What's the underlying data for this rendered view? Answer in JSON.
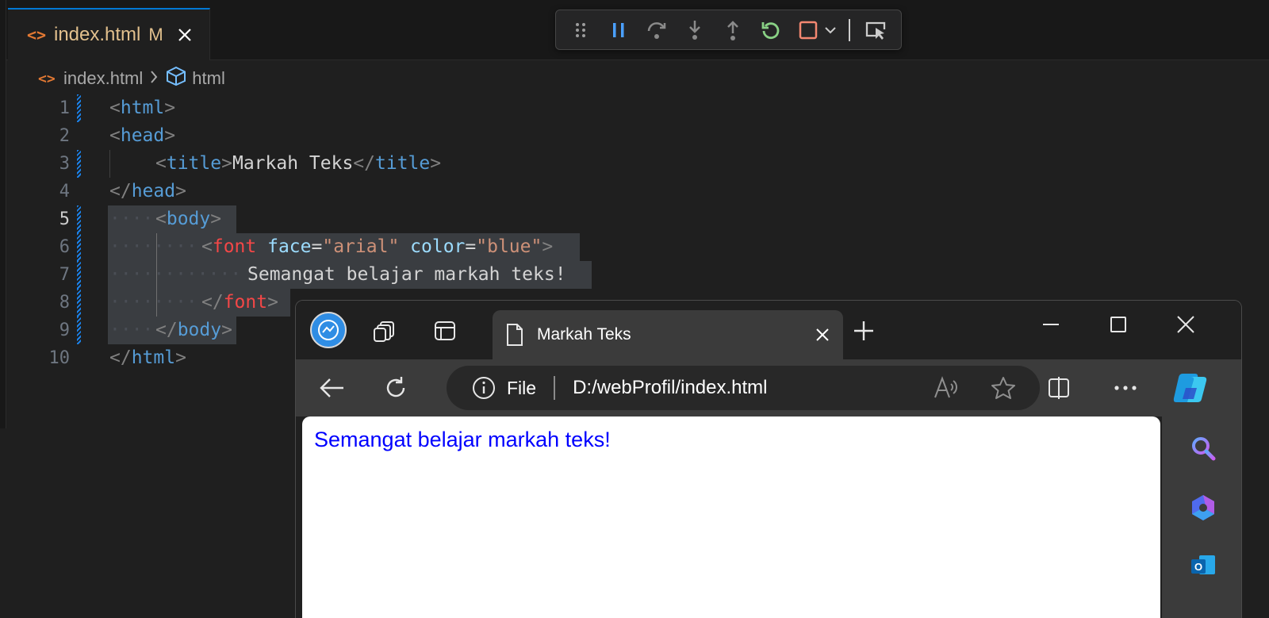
{
  "editor": {
    "tab": {
      "icon": "code-brackets-icon",
      "label": "index.html",
      "modified_badge": "M"
    },
    "breadcrumb": {
      "file": "index.html",
      "symbol": "html"
    },
    "debug_toolbar": [
      "drag-handle-icon",
      "pause-icon",
      "step-over-icon",
      "step-into-icon",
      "step-out-icon",
      "restart-icon",
      "stop-icon",
      "chevron-down-icon",
      "inspect-icon"
    ],
    "lines": [
      {
        "n": "1",
        "tokens": [
          "<",
          "html",
          ">"
        ]
      },
      {
        "n": "2",
        "tokens": [
          "<",
          "head",
          ">"
        ]
      },
      {
        "n": "3",
        "tokens": [
          "<",
          "title",
          ">",
          "Markah Teks",
          "</",
          "title",
          ">"
        ]
      },
      {
        "n": "4",
        "tokens": [
          "</",
          "head",
          ">"
        ]
      },
      {
        "n": "5",
        "tokens": [
          "<",
          "body",
          ">"
        ]
      },
      {
        "n": "6",
        "tokens": [
          "<",
          "font",
          " ",
          "face",
          "=",
          "\"arial\"",
          " ",
          "color",
          "=",
          "\"blue\"",
          ">"
        ]
      },
      {
        "n": "7",
        "tokens": [
          "Semangat belajar markah teks!"
        ]
      },
      {
        "n": "8",
        "tokens": [
          "</",
          "font",
          ">"
        ]
      },
      {
        "n": "9",
        "tokens": [
          "</",
          "body",
          ">"
        ]
      },
      {
        "n": "10",
        "tokens": [
          "</",
          "html",
          ">"
        ]
      }
    ]
  },
  "browser": {
    "tab_title": "Markah Teks",
    "address": {
      "scheme_label": "File",
      "url": "D:/webProfil/index.html"
    },
    "page": {
      "text": "Semangat belajar markah teks!",
      "text_color": "#0000ff"
    }
  }
}
